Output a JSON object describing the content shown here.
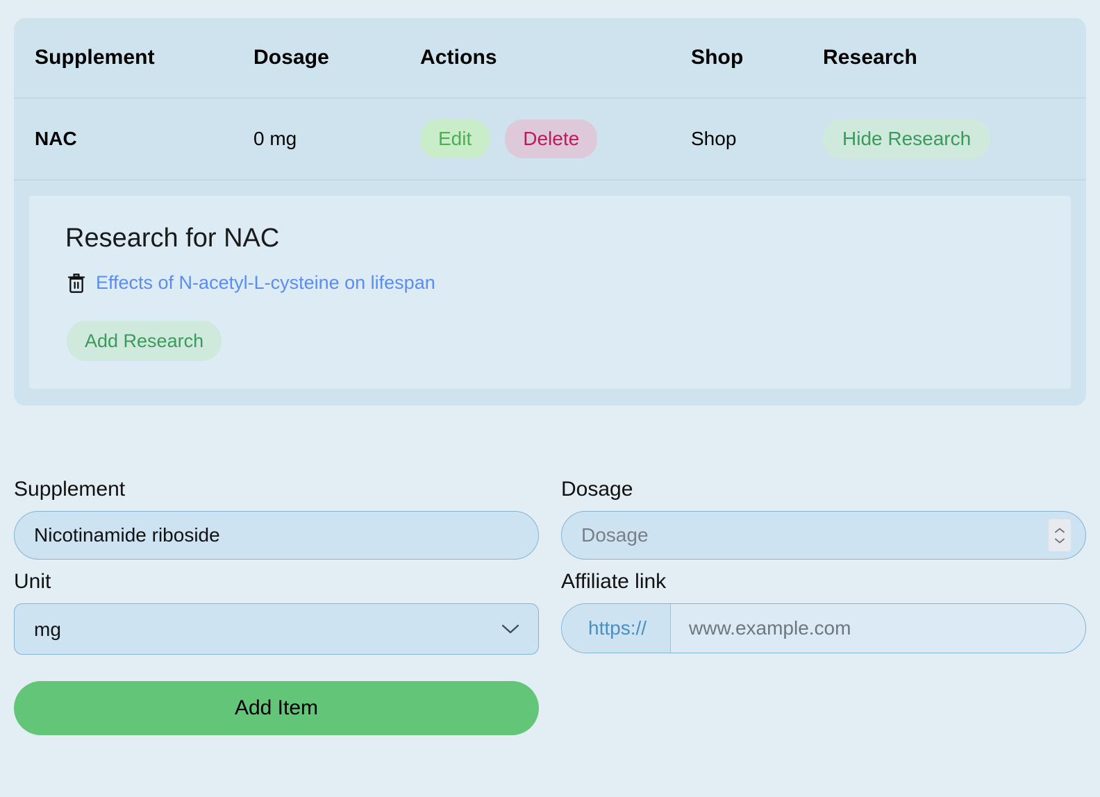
{
  "table": {
    "headers": {
      "supplement": "Supplement",
      "dosage": "Dosage",
      "actions": "Actions",
      "shop": "Shop",
      "research": "Research"
    },
    "rows": [
      {
        "name": "NAC",
        "dosage": "0 mg",
        "edit_label": "Edit",
        "delete_label": "Delete",
        "shop_label": "Shop",
        "research_toggle_label": "Hide Research"
      }
    ]
  },
  "research_panel": {
    "title": "Research for NAC",
    "items": [
      {
        "link_text": "Effects of N-acetyl-L-cysteine on lifespan"
      }
    ],
    "add_label": "Add Research"
  },
  "form": {
    "supplement": {
      "label": "Supplement",
      "value": "Nicotinamide riboside",
      "placeholder": "Supplement"
    },
    "dosage": {
      "label": "Dosage",
      "value": "",
      "placeholder": "Dosage"
    },
    "unit": {
      "label": "Unit",
      "value": "mg",
      "options": [
        "mg"
      ]
    },
    "affiliate": {
      "label": "Affiliate link",
      "prefix": "https://",
      "value": "",
      "placeholder": "www.example.com"
    },
    "submit_label": "Add Item"
  },
  "colors": {
    "page_background": "#e2eef3",
    "card_background": "#cfe3ef",
    "panel_background": "#dcebf4",
    "accent_green": "#63c578",
    "edit_green": "#4caf50",
    "delete_crimson": "#c2185b",
    "link_blue": "#5b8def",
    "input_background": "#cde3f1",
    "input_border": "#82b4d4"
  }
}
